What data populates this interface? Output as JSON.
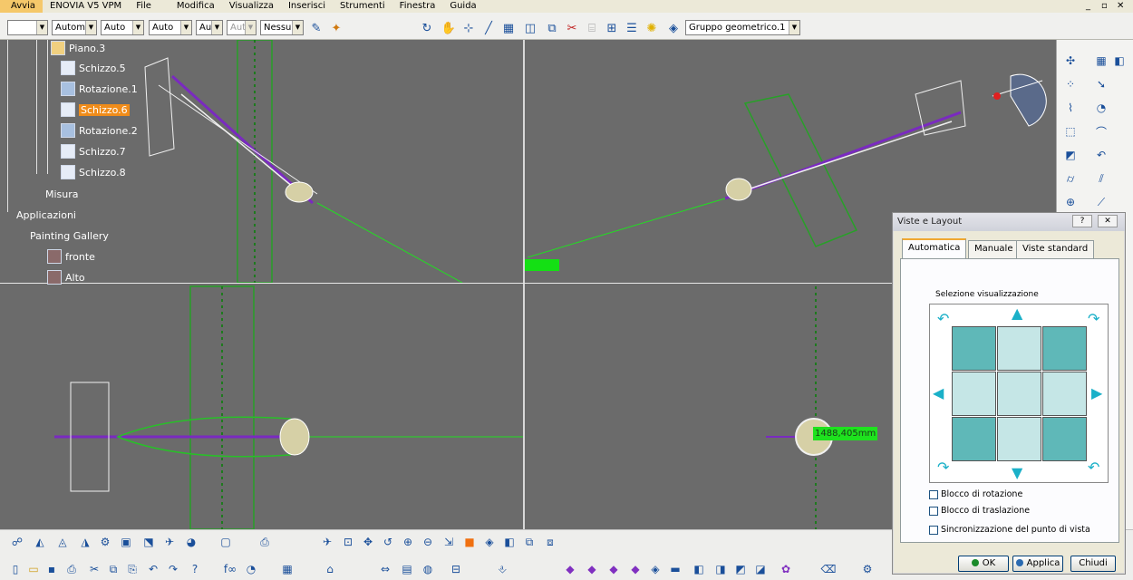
{
  "menubar": {
    "items": [
      "Avvia",
      "ENOVIA V5 VPM",
      "File",
      "Modifica",
      "Visualizza",
      "Inserisci",
      "Strumenti",
      "Finestra",
      "Guida"
    ],
    "window_controls": [
      "_",
      "▫",
      "✕"
    ]
  },
  "toolbar_top": {
    "selects": [
      {
        "value": "",
        "disabled": false
      },
      {
        "value": "Automa",
        "disabled": false
      },
      {
        "value": "Auto",
        "disabled": false
      },
      {
        "value": "Auto",
        "disabled": false
      },
      {
        "value": "Aut",
        "disabled": false
      },
      {
        "value": "Aut",
        "disabled": true
      },
      {
        "value": "Nessuno",
        "disabled": false
      }
    ],
    "geometry_set": "Gruppo geometrico.1"
  },
  "tree": {
    "items": [
      {
        "label": "Piano.3",
        "icon": "plane-icon",
        "selected": false
      },
      {
        "label": "Schizzo.5",
        "icon": "sketch-icon",
        "selected": false
      },
      {
        "label": "Rotazione.1",
        "icon": "revolve-icon",
        "selected": false
      },
      {
        "label": "Schizzo.6",
        "icon": "sketch-icon",
        "selected": true
      },
      {
        "label": "Rotazione.2",
        "icon": "revolve-icon",
        "selected": false
      },
      {
        "label": "Schizzo.7",
        "icon": "sketch-icon",
        "selected": false
      },
      {
        "label": "Schizzo.8",
        "icon": "sketch-icon",
        "selected": false
      }
    ],
    "misura": "Misura",
    "applicazioni": "Applicazioni",
    "painting_gallery": "Painting Gallery",
    "gallery_items": [
      "fronte",
      "Alto"
    ]
  },
  "measurement": "1488,405mm",
  "dialog": {
    "title": "Viste e Layout",
    "help": "?",
    "close": "✕",
    "tabs": [
      "Automatica",
      "Manuale",
      "Viste standard"
    ],
    "active_tab": "Automatica",
    "group_title": "Selezione visualizzazione",
    "checkboxes": [
      {
        "label": "Blocco di rotazione",
        "checked": false
      },
      {
        "label": "Blocco di traslazione",
        "checked": false
      },
      {
        "label": "Sincronizzazione del punto di vista",
        "checked": false
      }
    ],
    "buttons": {
      "ok": "OK",
      "apply": "Applica",
      "close": "Chiudi"
    }
  },
  "colors": {
    "selection": "#f08c1a",
    "viewport_bg": "#6b6b6b",
    "measure_bg": "#1ee21e",
    "accent_teal": "#5fb8b8"
  }
}
